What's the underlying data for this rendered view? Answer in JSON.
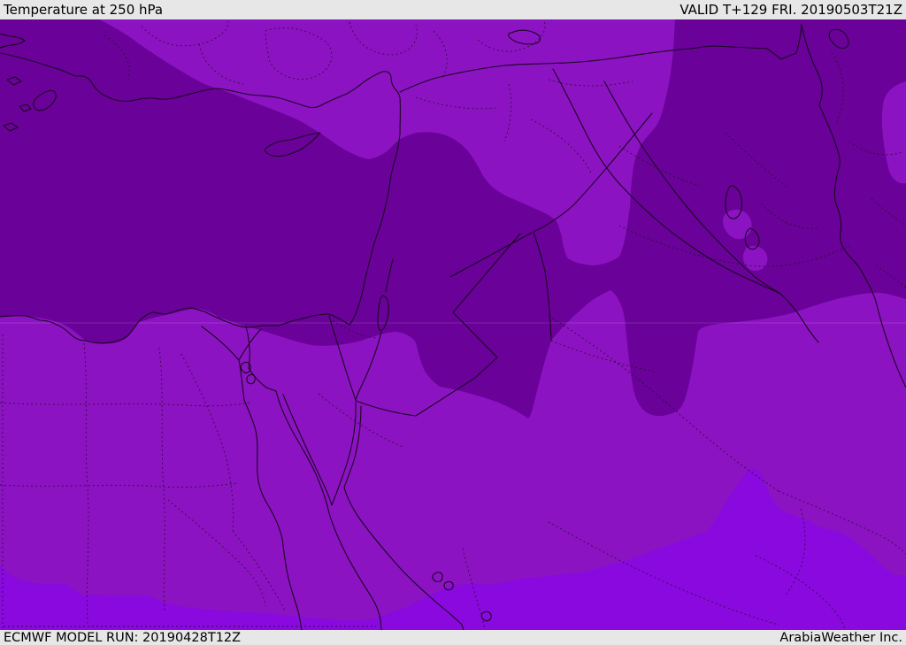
{
  "title_bar": {
    "title": "Temperature at 250 hPa",
    "valid_time": "VALID T+129 FRI. 20190503T21Z"
  },
  "footer_bar": {
    "model_run": "ECMWF MODEL RUN: 20190428T12Z",
    "credit": "ArabiaWeather Inc."
  },
  "map": {
    "colors": {
      "band_dark": "#6a0199",
      "band_medium": "#8c13c2",
      "band_bright": "#8a09df",
      "coastline": "#1a0520",
      "border_dashed": "#240a2c",
      "gridline": "rgba(255,255,255,0.14)",
      "bar_background": "#e7e7e7",
      "bar_text": "#000000"
    }
  }
}
